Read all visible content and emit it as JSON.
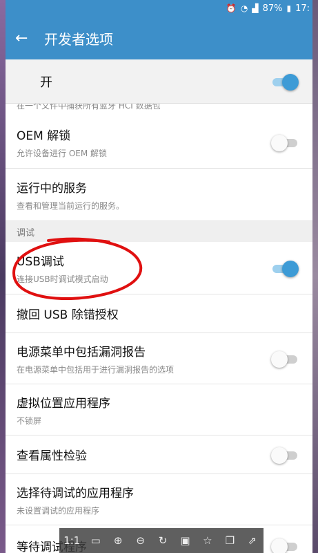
{
  "status": {
    "battery": "87%",
    "time": "17:",
    "icons": [
      "alarm-icon",
      "wifi-icon",
      "signal-icon",
      "battery-icon"
    ]
  },
  "appbar": {
    "title": "开发者选项"
  },
  "master": {
    "label": "开",
    "on": true
  },
  "partial_text": "在一个文件中捕获所有蓝牙 HCI 数据包",
  "items_top": [
    {
      "title": "OEM 解锁",
      "subtitle": "允许设备进行 OEM 解锁",
      "toggle": "off"
    },
    {
      "title": "运行中的服务",
      "subtitle": "查看和管理当前运行的服务。",
      "toggle": "none"
    }
  ],
  "section_debug": "调试",
  "items_debug": [
    {
      "title": "USB调试",
      "subtitle": "连接USB时调试模式启动",
      "toggle": "on"
    },
    {
      "title": "撤回 USB 除错授权",
      "subtitle": "",
      "toggle": "none"
    },
    {
      "title": "电源菜单中包括漏洞报告",
      "subtitle": "在电源菜单中包括用于进行漏洞报告的选项",
      "toggle": "off"
    },
    {
      "title": "虚拟位置应用程序",
      "subtitle": "不锁屏",
      "toggle": "none"
    },
    {
      "title": "查看属性检验",
      "subtitle": "",
      "toggle": "off"
    },
    {
      "title": "选择待调试的应用程序",
      "subtitle": "未设置调试的应用程序",
      "toggle": "none"
    },
    {
      "title": "等待调试程序",
      "subtitle": "",
      "toggle": "off"
    }
  ],
  "toolbar": {
    "zoom_label": "1:1",
    "tools": [
      "fit-screen-icon",
      "zoom-in-icon",
      "zoom-out-icon",
      "rotate-icon",
      "save-icon",
      "bookmark-icon",
      "copy-icon",
      "share-icon"
    ]
  },
  "colors": {
    "appbar": "#3d8fc9",
    "toggle_on": "#3d9bd6",
    "annotation": "#e01010"
  }
}
